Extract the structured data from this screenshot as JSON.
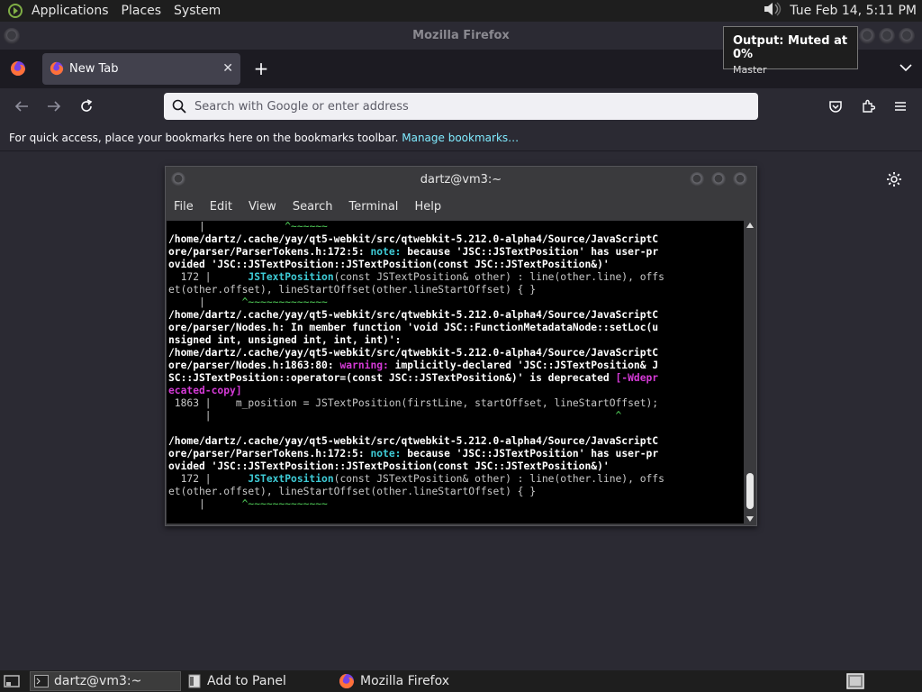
{
  "system_panel": {
    "menus": [
      "Applications",
      "Places",
      "System"
    ],
    "datetime": "Tue Feb 14,  5:11 PM"
  },
  "window": {
    "title": "Mozilla Firefox"
  },
  "tabs": [
    {
      "label": "New Tab"
    }
  ],
  "urlbar": {
    "placeholder": "Search with Google or enter address"
  },
  "bookmarks_bar": {
    "text": "For quick access, place your bookmarks here on the bookmarks toolbar.",
    "link": "Manage bookmarks…"
  },
  "terminal": {
    "title": "dartz@vm3:~",
    "menus": [
      "File",
      "Edit",
      "View",
      "Search",
      "Terminal",
      "Help"
    ],
    "lines": [
      "     |             ^~~~~~~",
      "/home/dartz/.cache/yay/qt5-webkit/src/qtwebkit-5.212.0-alpha4/Source/JavaScriptC",
      "ore/parser/ParserTokens.h:172:5: note: because 'JSC::JSTextPosition' has user-pr",
      "ovided 'JSC::JSTextPosition::JSTextPosition(const JSC::JSTextPosition&)'",
      "  172 |      JSTextPosition(const JSTextPosition& other) : line(other.line), offs",
      "et(other.offset), lineStartOffset(other.lineStartOffset) { }",
      "     |      ^~~~~~~~~~~~~~",
      "/home/dartz/.cache/yay/qt5-webkit/src/qtwebkit-5.212.0-alpha4/Source/JavaScriptC",
      "ore/parser/Nodes.h: In member function 'void JSC::FunctionMetadataNode::setLoc(u",
      "nsigned int, unsigned int, int, int)':",
      "/home/dartz/.cache/yay/qt5-webkit/src/qtwebkit-5.212.0-alpha4/Source/JavaScriptC",
      "ore/parser/Nodes.h:1863:80: warning: implicitly-declared 'JSC::JSTextPosition& J",
      "SC::JSTextPosition::operator=(const JSC::JSTextPosition&)' is deprecated [-Wdepr",
      "ecated-copy]",
      " 1863 |    m_position = JSTextPosition(firstLine, startOffset, lineStartOffset);",
      "      |                                                                  ^",
      "",
      "/home/dartz/.cache/yay/qt5-webkit/src/qtwebkit-5.212.0-alpha4/Source/JavaScriptC",
      "ore/parser/ParserTokens.h:172:5: note: because 'JSC::JSTextPosition' has user-pr",
      "ovided 'JSC::JSTextPosition::JSTextPosition(const JSC::JSTextPosition&)'",
      "  172 |      JSTextPosition(const JSTextPosition& other) : line(other.line), offs",
      "et(other.offset), lineStartOffset(other.lineStartOffset) { }",
      "     |      ^~~~~~~~~~~~~~"
    ]
  },
  "osd": {
    "title": "Output: Muted at 0%",
    "subtitle": "Master"
  },
  "taskbar": {
    "items": [
      "dartz@vm3:~",
      "Add to Panel",
      "Mozilla Firefox"
    ]
  },
  "colors": {
    "firefox_bg": "#2b2a33",
    "tab_active": "#42414d",
    "link": "#80ebff",
    "terminal_bg": "#000000"
  },
  "icons": [
    "mate-logo-icon",
    "speaker-muted-icon",
    "firefox-icon",
    "close-icon",
    "plus-icon",
    "chevron-down-icon",
    "back-arrow-icon",
    "forward-arrow-icon",
    "reload-icon",
    "search-icon",
    "pocket-icon",
    "extensions-icon",
    "hamburger-menu-icon",
    "gear-icon",
    "terminal-icon",
    "show-desktop-icon",
    "workspace-icon"
  ]
}
